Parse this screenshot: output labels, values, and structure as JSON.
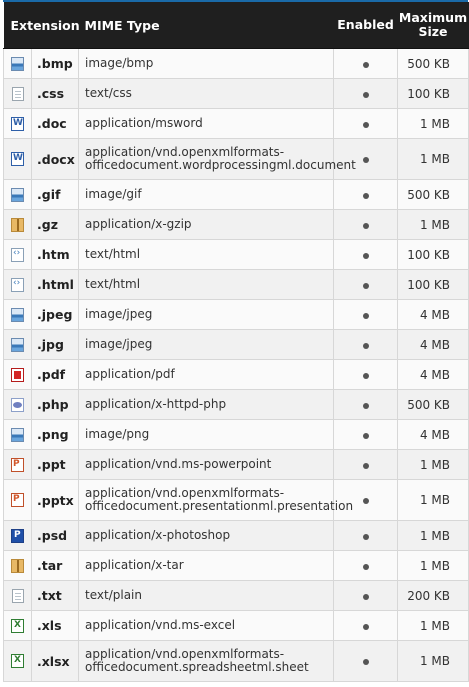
{
  "header": {
    "extension": "Extension",
    "mime": "MIME Type",
    "enabled": "Enabled",
    "max_line1": "Maximum",
    "max_line2": "Size"
  },
  "rows": [
    {
      "icon": "image",
      "ext": ".bmp",
      "mime1": "image/bmp",
      "mime2": "",
      "enabled": true,
      "max": "500 KB"
    },
    {
      "icon": "text",
      "ext": ".css",
      "mime1": "text/css",
      "mime2": "",
      "enabled": true,
      "max": "100 KB"
    },
    {
      "icon": "word",
      "ext": ".doc",
      "mime1": "application/msword",
      "mime2": "",
      "enabled": true,
      "max": "1 MB"
    },
    {
      "icon": "word",
      "ext": ".docx",
      "mime1": "application/vnd.openxmlformats-",
      "mime2": "officedocument.wordprocessingml.document",
      "enabled": true,
      "max": "1 MB"
    },
    {
      "icon": "image",
      "ext": ".gif",
      "mime1": "image/gif",
      "mime2": "",
      "enabled": true,
      "max": "500 KB"
    },
    {
      "icon": "archive",
      "ext": ".gz",
      "mime1": "application/x-gzip",
      "mime2": "",
      "enabled": true,
      "max": "1 MB"
    },
    {
      "icon": "html",
      "ext": ".htm",
      "mime1": "text/html",
      "mime2": "",
      "enabled": true,
      "max": "100 KB"
    },
    {
      "icon": "html",
      "ext": ".html",
      "mime1": "text/html",
      "mime2": "",
      "enabled": true,
      "max": "100 KB"
    },
    {
      "icon": "image",
      "ext": ".jpeg",
      "mime1": "image/jpeg",
      "mime2": "",
      "enabled": true,
      "max": "4 MB"
    },
    {
      "icon": "image",
      "ext": ".jpg",
      "mime1": "image/jpeg",
      "mime2": "",
      "enabled": true,
      "max": "4 MB"
    },
    {
      "icon": "pdf",
      "ext": ".pdf",
      "mime1": "application/pdf",
      "mime2": "",
      "enabled": true,
      "max": "4 MB"
    },
    {
      "icon": "php",
      "ext": ".php",
      "mime1": "application/x-httpd-php",
      "mime2": "",
      "enabled": true,
      "max": "500 KB"
    },
    {
      "icon": "image",
      "ext": ".png",
      "mime1": "image/png",
      "mime2": "",
      "enabled": true,
      "max": "4 MB"
    },
    {
      "icon": "ppt",
      "ext": ".ppt",
      "mime1": "application/vnd.ms-powerpoint",
      "mime2": "",
      "enabled": true,
      "max": "1 MB"
    },
    {
      "icon": "ppt",
      "ext": ".pptx",
      "mime1": "application/vnd.openxmlformats-",
      "mime2": "officedocument.presentationml.presentation",
      "enabled": true,
      "max": "1 MB"
    },
    {
      "icon": "psd",
      "ext": ".psd",
      "mime1": "application/x-photoshop",
      "mime2": "",
      "enabled": true,
      "max": "1 MB"
    },
    {
      "icon": "archive",
      "ext": ".tar",
      "mime1": "application/x-tar",
      "mime2": "",
      "enabled": true,
      "max": "1 MB"
    },
    {
      "icon": "text",
      "ext": ".txt",
      "mime1": "text/plain",
      "mime2": "",
      "enabled": true,
      "max": "200 KB"
    },
    {
      "icon": "excel",
      "ext": ".xls",
      "mime1": "application/vnd.ms-excel",
      "mime2": "",
      "enabled": true,
      "max": "1 MB"
    },
    {
      "icon": "excel",
      "ext": ".xlsx",
      "mime1": "application/vnd.openxmlformats-",
      "mime2": "officedocument.spreadsheetml.sheet",
      "enabled": true,
      "max": "1 MB"
    }
  ]
}
